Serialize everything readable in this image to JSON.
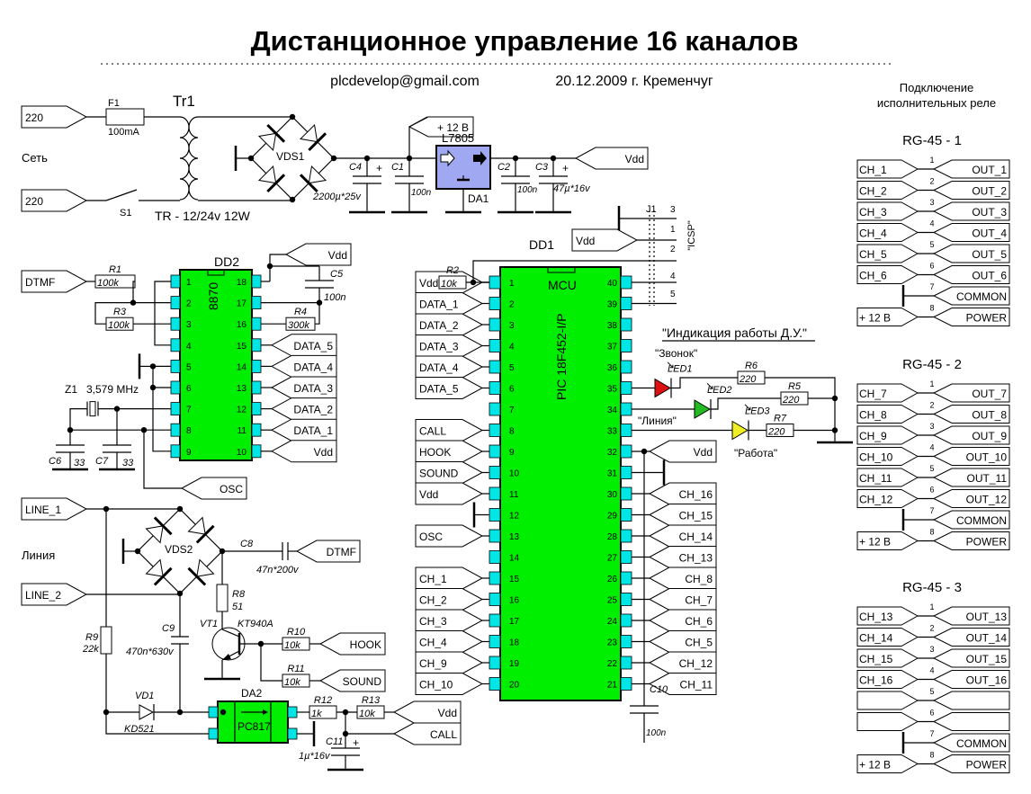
{
  "title": "Дистанционное управление 16 каналов",
  "author_email": "plcdevelop@gmail.com",
  "date_place": "20.12.2009 г. Кременчуг",
  "power": {
    "inputs": [
      "220",
      "220"
    ],
    "mains_label": "Сеть",
    "fuse": {
      "ref": "F1",
      "value": "100mA"
    },
    "switch": "S1",
    "transformer": {
      "ref": "Tr1",
      "value": "TR - 12/24v 12W"
    },
    "bridge": "VDS1",
    "plus12": "+ 12 В",
    "regulator": {
      "name": "L7805",
      "ref": "DA1"
    },
    "vdd": "Vdd",
    "caps": [
      {
        "ref": "C4",
        "value": "2200µ*25v"
      },
      {
        "ref": "C1",
        "value": "100n"
      },
      {
        "ref": "C2",
        "value": "100n"
      },
      {
        "ref": "C3",
        "value": "47µ*16v"
      }
    ]
  },
  "dtmf": {
    "ref": "DD2",
    "chip": "8870",
    "left_pins": [
      "1",
      "2",
      "3",
      "4",
      "5",
      "6",
      "7",
      "8",
      "9"
    ],
    "right_pins": [
      "18",
      "17",
      "16",
      "15",
      "14",
      "13",
      "12",
      "11",
      "10"
    ],
    "input": "DTMF",
    "r1": {
      "ref": "R1",
      "value": "100k"
    },
    "r3": {
      "ref": "R3",
      "value": "100k"
    },
    "r4": {
      "ref": "R4",
      "value": "300k"
    },
    "c5": {
      "ref": "C5",
      "value": "100n"
    },
    "vdd": "Vdd",
    "outputs": [
      "DATA_5",
      "DATA_4",
      "DATA_3",
      "DATA_2",
      "DATA_1",
      "Vdd"
    ],
    "crystal": {
      "ref": "Z1",
      "value": "3,579 MHz"
    },
    "c6": {
      "ref": "C6",
      "value": "33"
    },
    "c7": {
      "ref": "C7",
      "value": "33"
    },
    "osc": "OSC"
  },
  "mcu": {
    "ref": "DD1",
    "label": "MCU",
    "chip": "PIC 18F452-I/P",
    "r2": {
      "ref": "R2",
      "value": "10k"
    },
    "left_pins": [
      "1",
      "2",
      "3",
      "4",
      "5",
      "6",
      "7",
      "8",
      "9",
      "10",
      "11",
      "12",
      "13",
      "14",
      "15",
      "16",
      "17",
      "18",
      "19",
      "20"
    ],
    "right_pins": [
      "40",
      "39",
      "38",
      "37",
      "36",
      "35",
      "34",
      "33",
      "32",
      "31",
      "30",
      "29",
      "28",
      "27",
      "26",
      "25",
      "24",
      "23",
      "22",
      "21"
    ],
    "left_labels": [
      "Vdd",
      "DATA_1",
      "DATA_2",
      "DATA_3",
      "DATA_4",
      "DATA_5",
      "",
      "CALL",
      "HOOK",
      "SOUND",
      "Vdd",
      "",
      "OSC",
      "",
      "CH_1",
      "CH_2",
      "CH_3",
      "CH_4",
      "CH_9",
      "CH_10"
    ],
    "right_labels": [
      "",
      "",
      "",
      "",
      "",
      "",
      "",
      "",
      "Vdd",
      "",
      "CH_16",
      "CH_15",
      "CH_14",
      "CH_13",
      "CH_8",
      "CH_7",
      "CH_6",
      "CH_5",
      "CH_12",
      "CH_11"
    ],
    "c10": {
      "ref": "C10",
      "value": "100n"
    }
  },
  "icsp": {
    "ref": "J1",
    "label": "\"ICSP\"",
    "pins": [
      "3",
      "1",
      "2",
      "4",
      "5"
    ],
    "vdd": "Vdd"
  },
  "indication": {
    "title": "\"Индикация работы Д.У.\"",
    "leds": [
      {
        "ref": "LED1",
        "name": "\"Звонок\"",
        "color": "#dd1111",
        "resistor": "R6",
        "value": "220"
      },
      {
        "ref": "LED2",
        "name": "\"Линия\"",
        "color": "#22bb22",
        "resistor": "R5",
        "value": "220"
      },
      {
        "ref": "LED3",
        "name": "\"Работа\"",
        "color": "#eeee22",
        "resistor": "R7",
        "value": "220"
      }
    ]
  },
  "line": {
    "inputs": [
      "LINE_1",
      "LINE_2"
    ],
    "label": "Линия",
    "bridge": "VDS2",
    "c8": {
      "ref": "C8",
      "value": "47n*200v"
    },
    "dtmf": "DTMF",
    "r8": {
      "ref": "R8",
      "value": "51"
    },
    "r9": {
      "ref": "R9",
      "value": "22k"
    },
    "c9": {
      "ref": "C9",
      "value": "470n*630v"
    },
    "vt1": {
      "ref": "VT1",
      "value": "KT940A"
    },
    "r10": {
      "ref": "R10",
      "value": "10k"
    },
    "r11": {
      "ref": "R11",
      "value": "10k"
    },
    "hook": "HOOK",
    "sound": "SOUND",
    "vd1": {
      "ref": "VD1",
      "value": "KD521"
    },
    "opto": {
      "ref": "DA2",
      "value": "PC817"
    },
    "r12": {
      "ref": "R12",
      "value": "1k"
    },
    "r13": {
      "ref": "R13",
      "value": "10k"
    },
    "c11": {
      "ref": "C11",
      "value": "1µ*16v"
    },
    "vdd": "Vdd",
    "call": "CALL"
  },
  "relays": {
    "title_line1": "Подключение",
    "title_line2": "исполнительных реле",
    "connectors": [
      {
        "name": "RG-45 - 1",
        "rows": [
          [
            "CH_1",
            "1",
            "OUT_1"
          ],
          [
            "CH_2",
            "2",
            "OUT_2"
          ],
          [
            "CH_3",
            "3",
            "OUT_3"
          ],
          [
            "CH_4",
            "4",
            "OUT_4"
          ],
          [
            "CH_5",
            "5",
            "OUT_5"
          ],
          [
            "CH_6",
            "6",
            "OUT_6"
          ],
          [
            "",
            "7",
            "COMMON"
          ],
          [
            "+ 12 В",
            "8",
            "POWER"
          ]
        ]
      },
      {
        "name": "RG-45 - 2",
        "rows": [
          [
            "CH_7",
            "1",
            "OUT_7"
          ],
          [
            "CH_8",
            "2",
            "OUT_8"
          ],
          [
            "CH_9",
            "3",
            "OUT_9"
          ],
          [
            "CH_10",
            "4",
            "OUT_10"
          ],
          [
            "CH_11",
            "5",
            "OUT_11"
          ],
          [
            "CH_12",
            "6",
            "OUT_12"
          ],
          [
            "",
            "7",
            "COMMON"
          ],
          [
            "+ 12 В",
            "8",
            "POWER"
          ]
        ]
      },
      {
        "name": "RG-45 - 3",
        "rows": [
          [
            "CH_13",
            "1",
            "OUT_13"
          ],
          [
            "CH_14",
            "2",
            "OUT_14"
          ],
          [
            "CH_15",
            "3",
            "OUT_15"
          ],
          [
            "CH_16",
            "4",
            "OUT_16"
          ],
          [
            "",
            "5",
            ""
          ],
          [
            "",
            "6",
            ""
          ],
          [
            "",
            "7",
            "COMMON"
          ],
          [
            "+ 12 В",
            "8",
            "POWER"
          ]
        ]
      }
    ]
  }
}
